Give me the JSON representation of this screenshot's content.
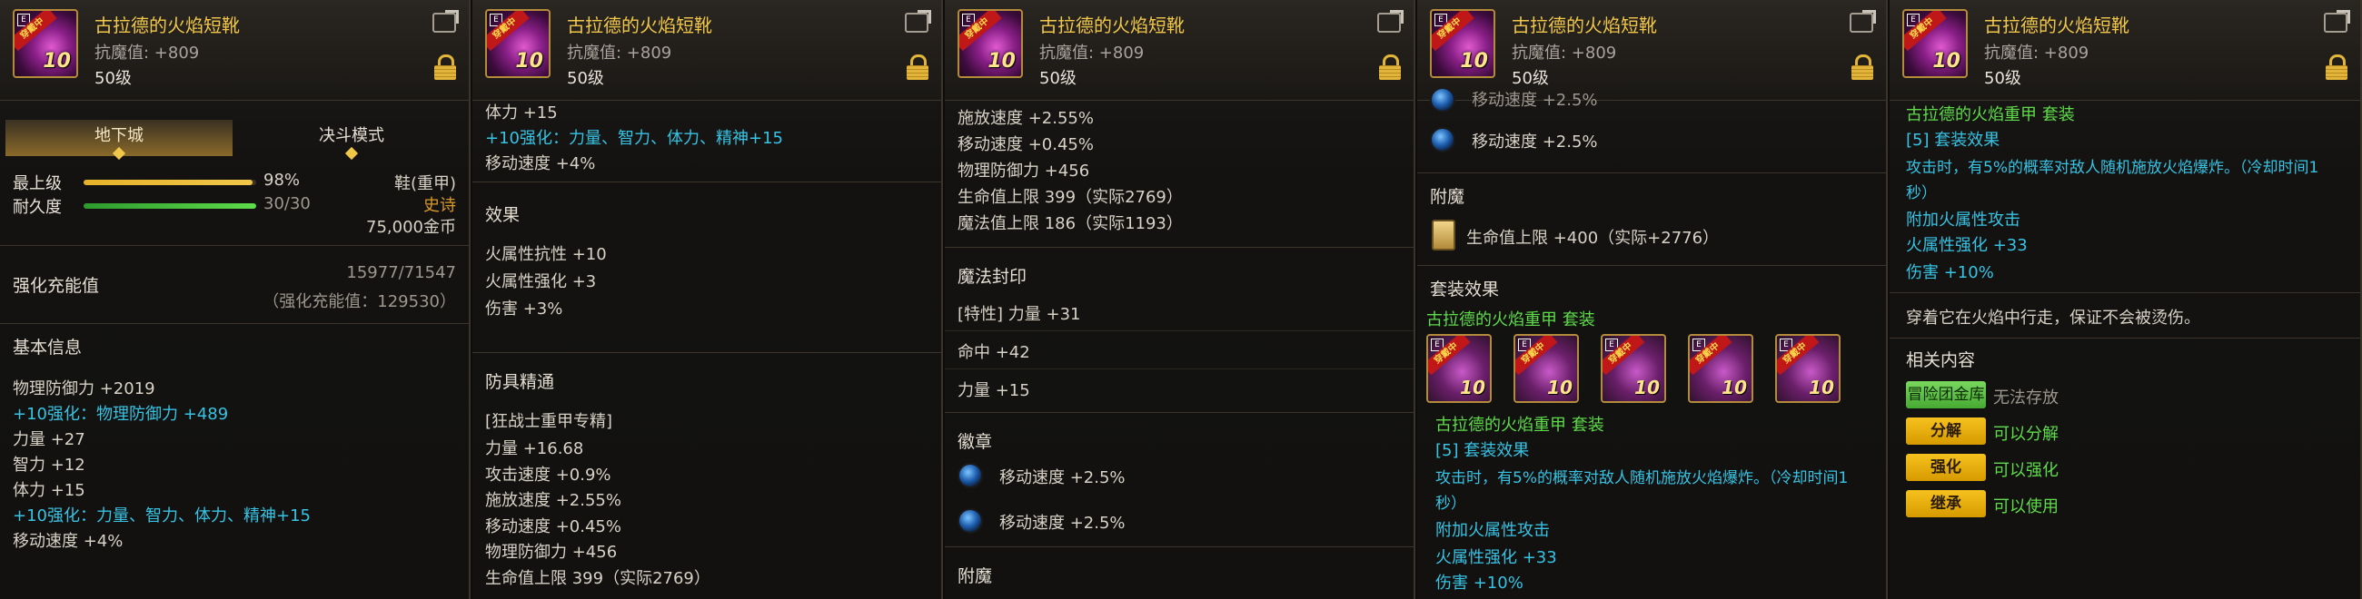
{
  "item": {
    "name": "古拉德的火焰短靴",
    "resist": "抗魔值: +809",
    "level": "50级",
    "icon_level": "10",
    "icon_corner": "E",
    "ribbon": "穿戴中"
  },
  "p1": {
    "tab_dungeon": "地下城",
    "tab_pvp": "决斗模式",
    "grade_label": "最上级",
    "grade_value": "98%",
    "grade_fill": 0.98,
    "durability_label": "耐久度",
    "durability_value": "30/30",
    "durability_fill": 1.0,
    "type": "鞋(重甲)",
    "rarity": "史诗",
    "price": "75,000金币",
    "charge_label": "强化充能值",
    "charge_value": "15977/71547",
    "charge_sub": "（强化充能值：129530）",
    "basic_info": "基本信息",
    "stats": [
      {
        "text": "物理防御力 +2019",
        "style": "white"
      },
      {
        "text": "+10强化：物理防御力 +489",
        "style": "cyan"
      },
      {
        "text": "力量 +27",
        "style": "white"
      },
      {
        "text": "智力 +12",
        "style": "white"
      },
      {
        "text": "体力 +15",
        "style": "white"
      },
      {
        "text": "+10强化：力量、智力、体力、精神+15",
        "style": "cyan"
      },
      {
        "text": "移动速度 +4%",
        "style": "white"
      }
    ]
  },
  "p2": {
    "top": [
      {
        "text": "体力 +15",
        "style": "white"
      },
      {
        "text": "+10强化：力量、智力、体力、精神+15",
        "style": "cyan"
      },
      {
        "text": "移动速度 +4%",
        "style": "white"
      }
    ],
    "effect_title": "效果",
    "effects": [
      "火属性抗性 +10",
      "火属性强化 +3",
      "伤害 +3%"
    ],
    "mastery_title": "防具精通",
    "mastery_class": "[狂战士重甲专精]",
    "mastery": [
      "力量 +16.68",
      "攻击速度 +0.9%",
      "施放速度 +2.55%",
      "移动速度 +0.45%",
      "物理防御力 +456",
      "生命值上限 399（实际2769）"
    ]
  },
  "p3": {
    "top": [
      "施放速度 +2.55%",
      "移动速度 +0.45%",
      "物理防御力 +456",
      "生命值上限 399（实际2769）",
      "魔法值上限 186（实际1193）"
    ],
    "seal_title": "魔法封印",
    "seal_special": "[特性] 力量 +31",
    "seal_hit": "命中 +42",
    "seal_str": "力量 +15",
    "emblem_title": "徽章",
    "emblems": [
      "移动速度 +2.5%",
      "移动速度 +2.5%"
    ],
    "enchant_title": "附魔"
  },
  "p4": {
    "cut_text": "移动速度 +2.5%",
    "emblem": "移动速度 +2.5%",
    "enchant_title": "附魔",
    "enchant": "生命值上限 +400（实际+2776）",
    "set_title": "套装效果",
    "set_name": "古拉德的火焰重甲 套装",
    "set_icons": [
      "10",
      "10",
      "10",
      "10",
      "10"
    ],
    "set_name2": "古拉德的火焰重甲 套装",
    "set_bonus": "[5] 套装效果",
    "set_desc1": "攻击时，有5%的概率对敌人随机施放火焰爆炸。（冷却时间1",
    "set_desc2": "秒）",
    "extra1": "附加火属性攻击",
    "extra2": "火属性强化 +33",
    "extra3": "伤害 +10%"
  },
  "p5": {
    "set_name": "古拉德的火焰重甲 套装",
    "set_bonus": "[5] 套装效果",
    "set_desc1": "攻击时，有5%的概率对敌人随机施放火焰爆炸。（冷却时间1",
    "set_desc2": "秒）",
    "extra1": "附加火属性攻击",
    "extra2": "火属性强化 +33",
    "extra3": "伤害 +10%",
    "flavor": "穿着它在火焰中行走，保证不会被烫伤。",
    "related_title": "相关内容",
    "rows": [
      {
        "btn": "冒险团金库",
        "text": "无法存放",
        "btn_style": "green",
        "text_style": "gray"
      },
      {
        "btn": "分解",
        "text": "可以分解",
        "btn_style": "gold",
        "text_style": "green"
      },
      {
        "btn": "强化",
        "text": "可以强化",
        "btn_style": "gold",
        "text_style": "green"
      },
      {
        "btn": "继承",
        "text": "可以使用",
        "btn_style": "gold",
        "text_style": "green"
      }
    ]
  }
}
